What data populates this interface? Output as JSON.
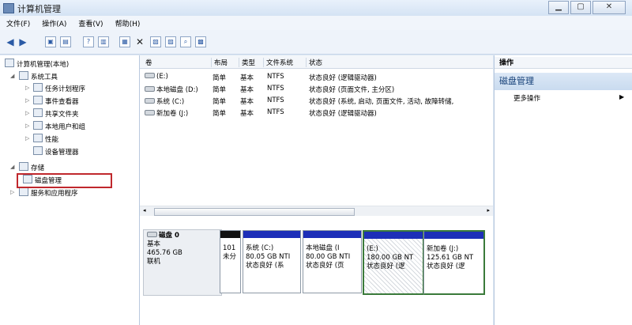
{
  "window": {
    "title": "计算机管理"
  },
  "menu": [
    "文件(F)",
    "操作(A)",
    "查看(V)",
    "帮助(H)"
  ],
  "toolbar": {
    "back": "◀",
    "forward": "▶",
    "close_x": "✕"
  },
  "tree": {
    "root": "计算机管理(本地)",
    "system_tools": "系统工具",
    "task_scheduler": "任务计划程序",
    "event_viewer": "事件查看器",
    "shared_folders": "共享文件夹",
    "local_users": "本地用户和组",
    "performance": "性能",
    "device_manager": "设备管理器",
    "storage": "存储",
    "disk_management": "磁盘管理",
    "services": "服务和应用程序"
  },
  "columns": [
    "卷",
    "布局",
    "类型",
    "文件系统",
    "状态"
  ],
  "volumes": [
    {
      "name": "(E:)",
      "layout": "简单",
      "type": "基本",
      "fs": "NTFS",
      "status": "状态良好 (逻辑驱动器)"
    },
    {
      "name": "本地磁盘 (D:)",
      "layout": "简单",
      "type": "基本",
      "fs": "NTFS",
      "status": "状态良好 (页面文件, 主分区)"
    },
    {
      "name": "系统 (C:)",
      "layout": "简单",
      "type": "基本",
      "fs": "NTFS",
      "status": "状态良好 (系统, 启动, 页面文件, 活动, 故障转储,"
    },
    {
      "name": "新加卷 (J:)",
      "layout": "简单",
      "type": "基本",
      "fs": "NTFS",
      "status": "状态良好 (逻辑驱动器)"
    }
  ],
  "disk": {
    "name": "磁盘 0",
    "kind": "基本",
    "size": "465.76 GB",
    "state": "联机"
  },
  "partitions": [
    {
      "title": "",
      "size": "101",
      "status": "未分"
    },
    {
      "title": "系统  (C:)",
      "size": "80.05 GB NTI",
      "status": "状态良好 (系"
    },
    {
      "title": "本地磁盘  (I",
      "size": "80.00 GB NTI",
      "status": "状态良好 (页"
    },
    {
      "title": "(E:)",
      "size": "180.00 GB NT",
      "status": "状态良好 (逻"
    },
    {
      "title": "新加卷  (J:)",
      "size": "125.61 GB NT",
      "status": "状态良好 (逻"
    }
  ],
  "actions": {
    "header": "操作",
    "section": "磁盘管理",
    "more": "更多操作"
  }
}
